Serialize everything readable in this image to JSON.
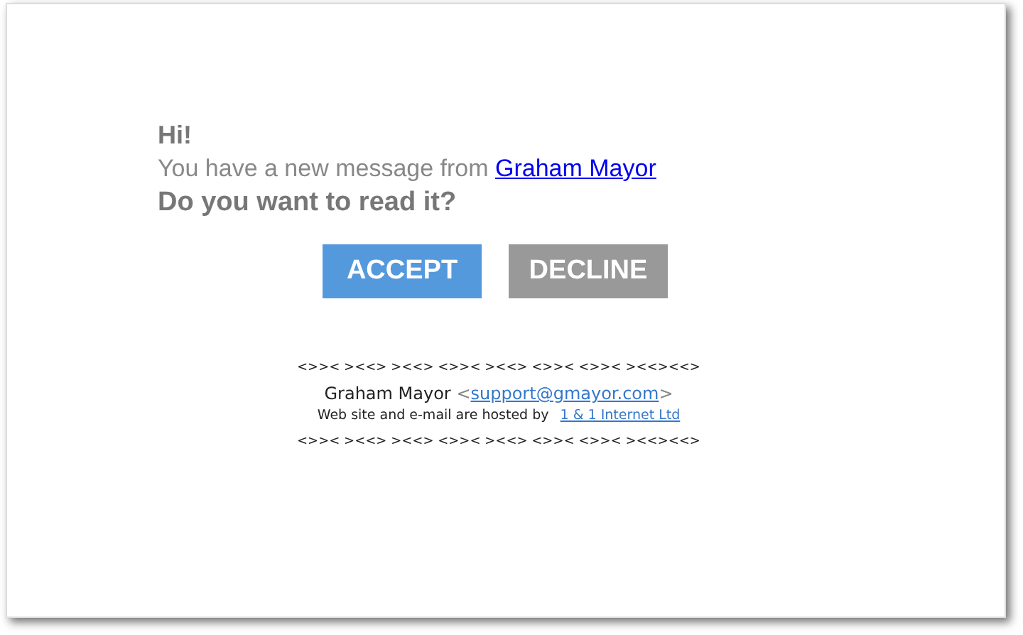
{
  "email": {
    "greeting": "Hi!",
    "message": {
      "text": "You have a new message from",
      "sender_link": "Graham Mayor"
    },
    "question": "Do you want to read it?",
    "buttons": [
      {
        "label": "ACCEPT",
        "kind": "primary"
      },
      {
        "label": "DECLINE",
        "kind": "secondary"
      }
    ],
    "footer": {
      "divider_top": "<>>< ><<> ><<> <>>< ><<> <>>< <>>< ><<><<>",
      "signature": {
        "name": "Graham Mayor",
        "open": "<",
        "email_link": "support@gmayor.com",
        "close": ">"
      },
      "hosting": {
        "text": "Web site and e-mail are hosted by",
        "host_link": "1 & 1 Internet Ltd"
      },
      "divider_bottom": "<>>< ><<> ><<> <>>< ><<> <>>< <>>< ><<><<>"
    }
  }
}
